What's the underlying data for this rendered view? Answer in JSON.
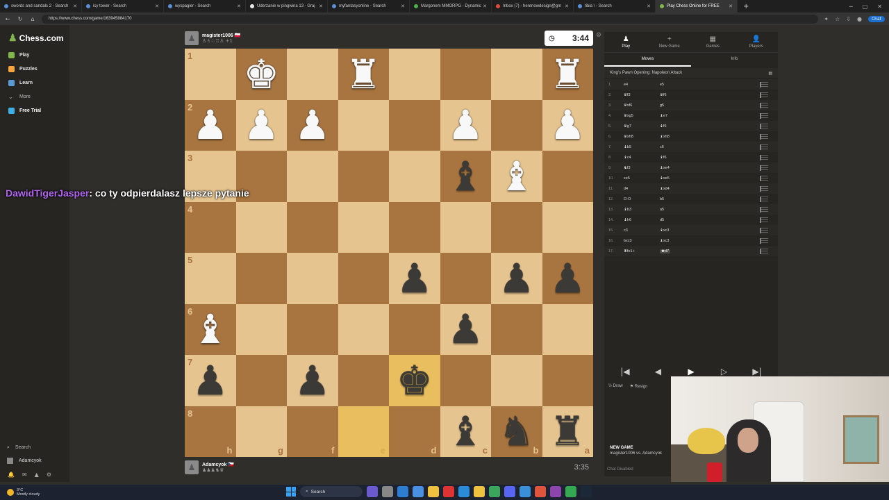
{
  "browser": {
    "tabs": [
      {
        "title": "swords and sandals 2 - Search",
        "color": "#5a8fd8"
      },
      {
        "title": "icy tower - Search",
        "color": "#5a8fd8"
      },
      {
        "title": "wyspagier - Search",
        "color": "#5a8fd8"
      },
      {
        "title": "Uderzanie w pingwina 13 - Graj",
        "color": "#e8e8e8"
      },
      {
        "title": "myfantasyonline - Search",
        "color": "#5a8fd8"
      },
      {
        "title": "Margonem MMORPG - Dynamic",
        "color": "#4caf50"
      },
      {
        "title": "Inbox (7) - herenowdesign@gm",
        "color": "#e04b3b"
      },
      {
        "title": "tibia \\ - Search",
        "color": "#5a8fd8"
      },
      {
        "title": "Play Chess Online for FREE",
        "color": "#81b64c"
      }
    ],
    "active_tab_index": 8,
    "url": "https://www.chess.com/game/163945884170",
    "chat_button": "Chat"
  },
  "sidebar": {
    "brand": "Chess.com",
    "items": [
      {
        "label": "Play",
        "color": "#81b64c"
      },
      {
        "label": "Puzzles",
        "color": "#f7a53a"
      },
      {
        "label": "Learn",
        "color": "#5b9bd5"
      },
      {
        "label": "More",
        "color": "#888888"
      },
      {
        "label": "Free Trial",
        "color": "#3fb0e8"
      }
    ],
    "search_label": "Search",
    "username": "Adamcyok"
  },
  "top_player": {
    "name": "magister1006",
    "flag": "🇵🇱",
    "captured": "♙♗♘♖♙ +1",
    "clock": "3:44"
  },
  "bottom_player": {
    "name": "Adamcyok",
    "flag": "🇨🇿",
    "captured": "♟♟♟♞♛",
    "clock": "3:35"
  },
  "board": {
    "ranks": [
      "1",
      "2",
      "3",
      "4",
      "5",
      "6",
      "7",
      "8"
    ],
    "files": [
      "h",
      "g",
      "f",
      "e",
      "d",
      "c",
      "b",
      "a"
    ],
    "light_color": "#e6c48f",
    "dark_color": "#a8743f",
    "highlight": [
      "e8",
      "d7"
    ],
    "rows": [
      [
        "",
        "wK",
        "",
        "wR",
        "",
        "",
        "",
        "wR"
      ],
      [
        "wP",
        "wP",
        "wP",
        "",
        "",
        "wP",
        "",
        "wP"
      ],
      [
        "",
        "",
        "",
        "",
        "",
        "bB",
        "wB",
        ""
      ],
      [
        "",
        "",
        "",
        "",
        "",
        "",
        "",
        ""
      ],
      [
        "",
        "",
        "",
        "",
        "bP",
        "",
        "bP",
        "bP"
      ],
      [
        "wB",
        "",
        "",
        "",
        "",
        "bP",
        "",
        ""
      ],
      [
        "bP",
        "",
        "bP",
        "",
        "bK",
        "",
        "",
        ""
      ],
      [
        "",
        "",
        "",
        "",
        "",
        "bB",
        "bN",
        "bR"
      ]
    ]
  },
  "chat_overlay": {
    "user": "DawidTigerJasper",
    "message": ": co ty odpierdalasz lepsze pytanie"
  },
  "panel": {
    "tabs": [
      {
        "label": "Play",
        "icon": "♟"
      },
      {
        "label": "New Game",
        "icon": "+"
      },
      {
        "label": "Games",
        "icon": "▦"
      },
      {
        "label": "Players",
        "icon": "👤"
      }
    ],
    "subtabs": [
      "Moves",
      "Info"
    ],
    "opening": "King's Pawn Opening: Napoleon Attack",
    "moves": [
      {
        "n": "1.",
        "w": "e4",
        "b": "e5"
      },
      {
        "n": "2.",
        "w": "♛f3",
        "b": "♛f6"
      },
      {
        "n": "3.",
        "w": "♛xf6",
        "b": "g5"
      },
      {
        "n": "4.",
        "w": "♛xg5",
        "b": "♝e7"
      },
      {
        "n": "5.",
        "w": "♛g7",
        "b": "♝f6"
      },
      {
        "n": "6.",
        "w": "♛xh8",
        "b": "♝xh8"
      },
      {
        "n": "7.",
        "w": "♝b5",
        "b": "c6"
      },
      {
        "n": "8.",
        "w": "♝c4",
        "b": "♝f6"
      },
      {
        "n": "9.",
        "w": "♞f3",
        "b": "♝xe4"
      },
      {
        "n": "10.",
        "w": "xe5",
        "b": "♝xe5"
      },
      {
        "n": "11.",
        "w": "d4",
        "b": "♝xd4"
      },
      {
        "n": "12.",
        "w": "O-O",
        "b": "b5"
      },
      {
        "n": "13.",
        "w": "♝b3",
        "b": "a5"
      },
      {
        "n": "14.",
        "w": "♝h6",
        "b": "d5"
      },
      {
        "n": "15.",
        "w": "c3",
        "b": "♝xc3"
      },
      {
        "n": "16.",
        "w": "bxc3",
        "b": "♝xc3"
      },
      {
        "n": "17.",
        "w": "♜fe1+",
        "b": "♚d7"
      }
    ],
    "controls": [
      "|◀",
      "◀",
      "▶",
      "▷",
      "▶|"
    ],
    "draw_label": "Draw",
    "resign_label": "Resign",
    "new_game_title": "NEW GAME",
    "new_game_sub": "magister1006 vs. Adamcyok",
    "chat_disabled": "Chat Disabled"
  },
  "taskbar": {
    "temp": "3°C",
    "weather": "Mostly cloudy",
    "search": "Search"
  }
}
